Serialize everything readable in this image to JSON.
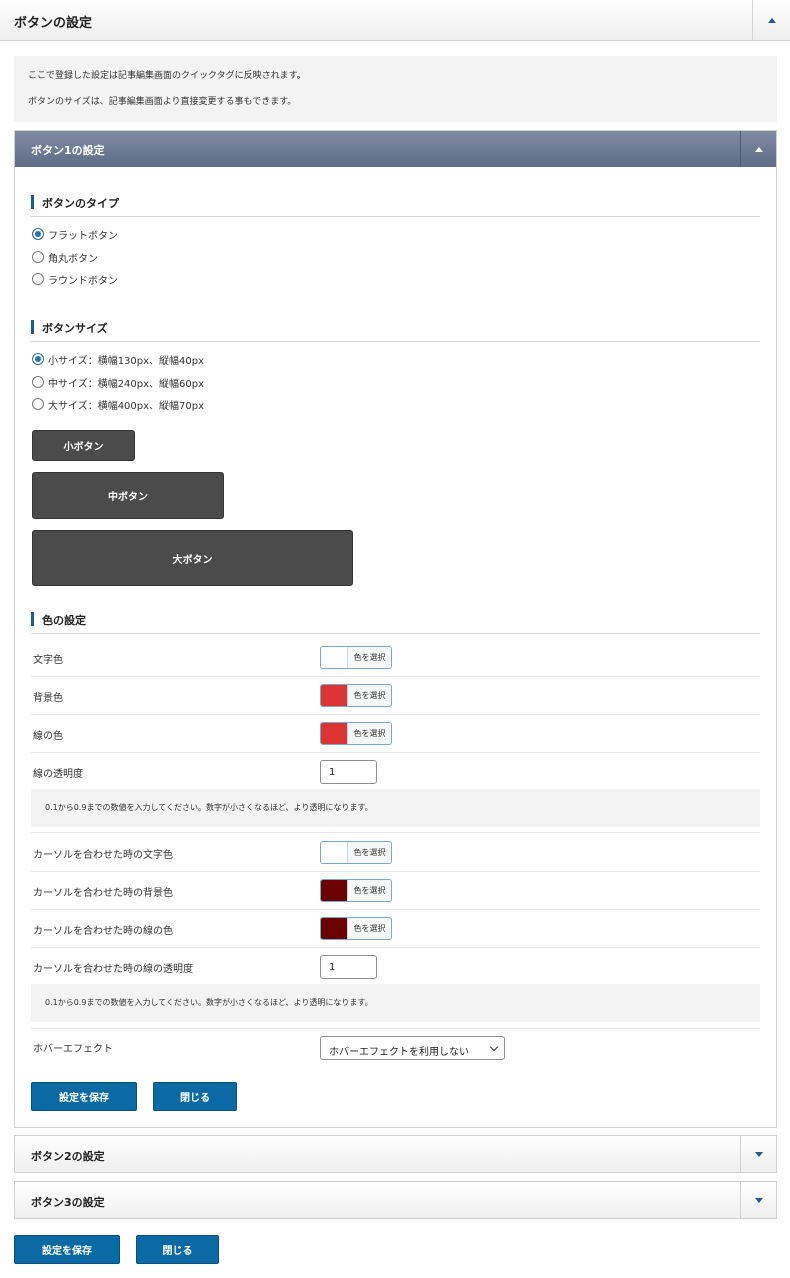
{
  "header": {
    "title": "ボタンの設定"
  },
  "info": {
    "line1": "ここで登録した設定は記事編集画面のクイックタグに反映されます。",
    "line2": "ボタンのサイズは、記事編集画面より直接変更する事もできます。"
  },
  "panel1": {
    "title": "ボタン1の設定",
    "type_section": {
      "title": "ボタンのタイプ",
      "options": [
        "フラットボタン",
        "角丸ボタン",
        "ラウンドボタン"
      ],
      "selected": "フラットボタン"
    },
    "size_section": {
      "title": "ボタンサイズ",
      "options": [
        "小サイズ：横幅130px、縦幅40px",
        "中サイズ：横幅240px、縦幅60px",
        "大サイズ：横幅400px、縦幅70px"
      ],
      "selected": "小サイズ：横幅130px、縦幅40px",
      "previews": [
        "小ボタン",
        "中ボタン",
        "大ボタン"
      ]
    },
    "color_section": {
      "title": "色の設定",
      "picker_label": "色を選択",
      "rows": [
        {
          "label": "文字色",
          "color": "#ffffff"
        },
        {
          "label": "背景色",
          "color": "#dd3333"
        },
        {
          "label": "線の色",
          "color": "#dd3333"
        },
        {
          "label": "線の透明度",
          "value": "1"
        },
        {
          "label": "カーソルを合わせた時の文字色",
          "color": "#ffffff"
        },
        {
          "label": "カーソルを合わせた時の背景色",
          "color": "#6b0000"
        },
        {
          "label": "カーソルを合わせた時の線の色",
          "color": "#6b0000"
        },
        {
          "label": "カーソルを合わせた時の線の透明度",
          "value": "1"
        },
        {
          "label": "ホバーエフェクト",
          "value": "ホバーエフェクトを利用しない"
        }
      ],
      "opacity_note": "0.1から0.9までの数値を入力してください。数字が小さくなるほど、より透明になります。"
    },
    "save_label": "設定を保存",
    "close_label": "閉じる"
  },
  "panel2": {
    "title": "ボタン2の設定"
  },
  "panel3": {
    "title": "ボタン3の設定"
  },
  "footer": {
    "save_label": "設定を保存",
    "close_label": "閉じる"
  }
}
